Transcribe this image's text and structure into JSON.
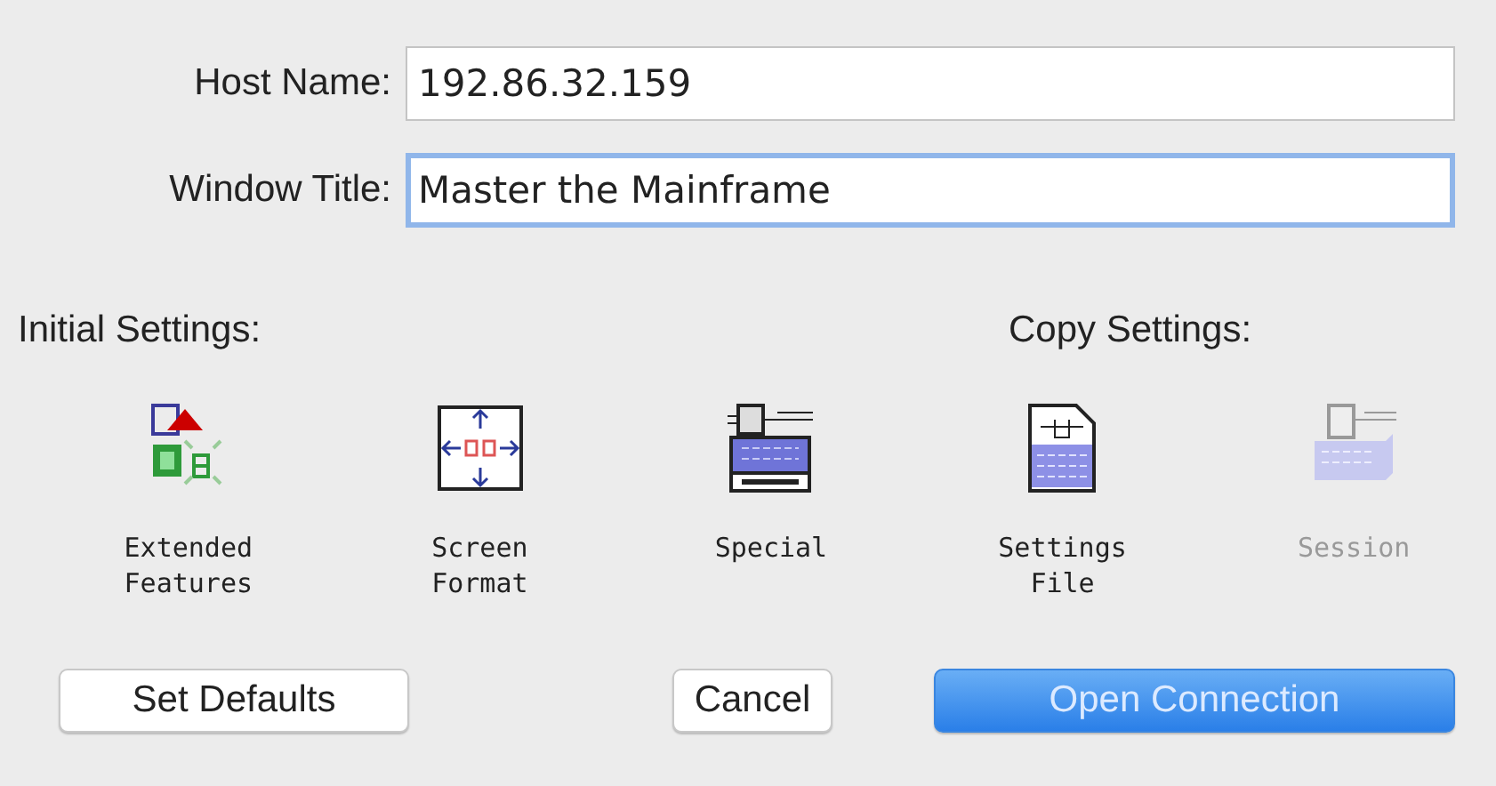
{
  "fields": [
    {
      "label": "Host Name:",
      "value": "192.86.32.159",
      "focused": false
    },
    {
      "label": "Window Title:",
      "value": "Master the Mainframe",
      "focused": true
    }
  ],
  "sections": [
    {
      "title": "Initial Settings:"
    },
    {
      "title": "Copy Settings:"
    }
  ],
  "icons": [
    {
      "kind": "extended",
      "label": "Extended Features",
      "disabled": false
    },
    {
      "kind": "format",
      "label": "Screen Format",
      "disabled": false
    },
    {
      "kind": "special",
      "label": "Special",
      "disabled": false
    },
    {
      "kind": "file",
      "label": "Settings File",
      "disabled": false
    },
    {
      "kind": "session",
      "label": "Session",
      "disabled": true
    }
  ],
  "buttons": [
    {
      "label": "Set Defaults",
      "default": false
    },
    {
      "label": "Cancel",
      "default": false
    },
    {
      "label": "Open Connection",
      "default": true
    }
  ]
}
